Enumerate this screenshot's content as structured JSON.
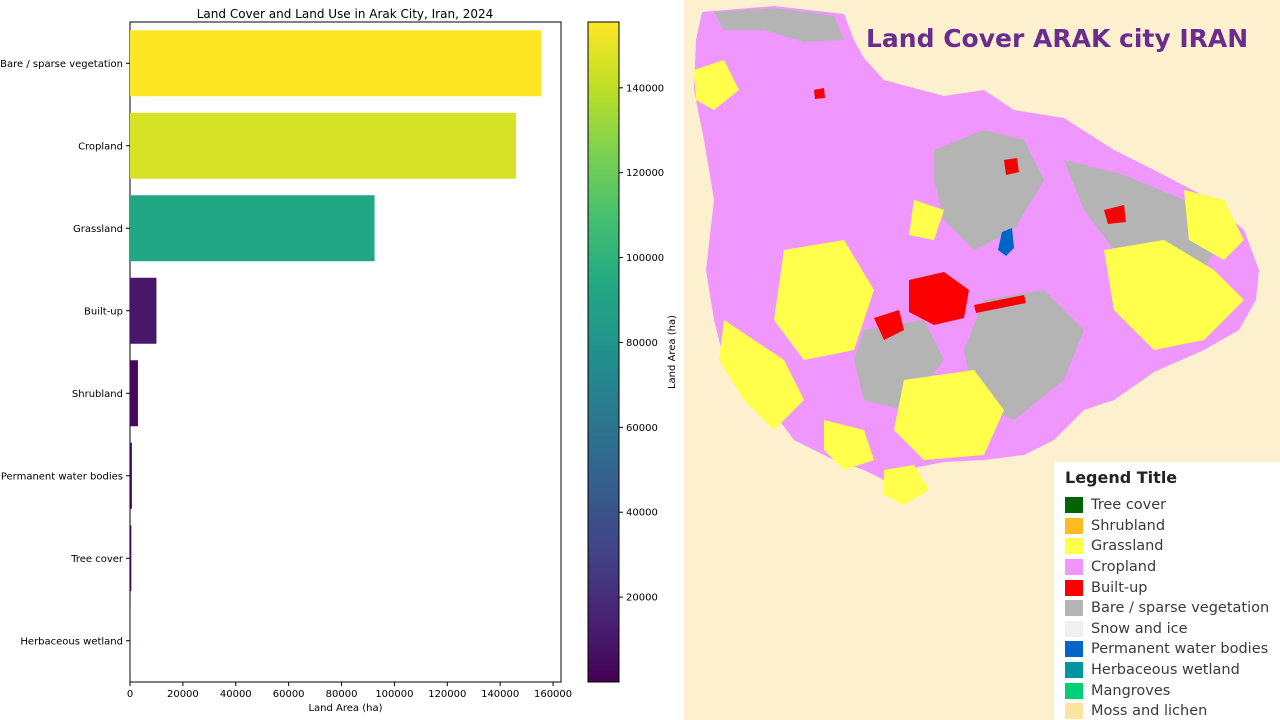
{
  "chart_data": {
    "type": "bar",
    "orientation": "horizontal",
    "title": "Land Cover and Land Use in Arak City, Iran, 2024",
    "xlabel": "Land Area (ha)",
    "ylabel": "",
    "categories": [
      "Bare / sparse vegetation",
      "Cropland",
      "Grassland",
      "Built-up",
      "Shrubland",
      "Permanent water bodies",
      "Tree cover",
      "Herbaceous wetland"
    ],
    "values": [
      155500,
      146000,
      92500,
      10000,
      3000,
      700,
      500,
      100
    ],
    "xlim": [
      0,
      163000
    ],
    "xticks": [
      0,
      20000,
      40000,
      60000,
      80000,
      100000,
      120000,
      140000,
      160000
    ],
    "colormap": "viridis",
    "colorbar": {
      "label": "Land Area (ha)",
      "range": [
        0,
        155500
      ],
      "ticks": [
        20000,
        40000,
        60000,
        80000,
        100000,
        120000,
        140000
      ]
    },
    "grid": false,
    "legend": "none"
  },
  "map": {
    "title": "Land Cover ARAK city IRAN",
    "legend_title": "Legend Title",
    "legend_items": [
      {
        "label": "Tree cover",
        "color": "#006400"
      },
      {
        "label": "Shrubland",
        "color": "#ffbb22"
      },
      {
        "label": "Grassland",
        "color": "#ffff4c"
      },
      {
        "label": "Cropland",
        "color": "#f096ff"
      },
      {
        "label": "Built-up",
        "color": "#fa0000"
      },
      {
        "label": "Bare / sparse vegetation",
        "color": "#b4b4b4"
      },
      {
        "label": "Snow and ice",
        "color": "#f0f0f0"
      },
      {
        "label": "Permanent water bodies",
        "color": "#0064c8"
      },
      {
        "label": "Herbaceous wetland",
        "color": "#0096a0"
      },
      {
        "label": "Mangroves",
        "color": "#00cf75"
      },
      {
        "label": "Moss and lichen",
        "color": "#fae6a0"
      }
    ]
  }
}
